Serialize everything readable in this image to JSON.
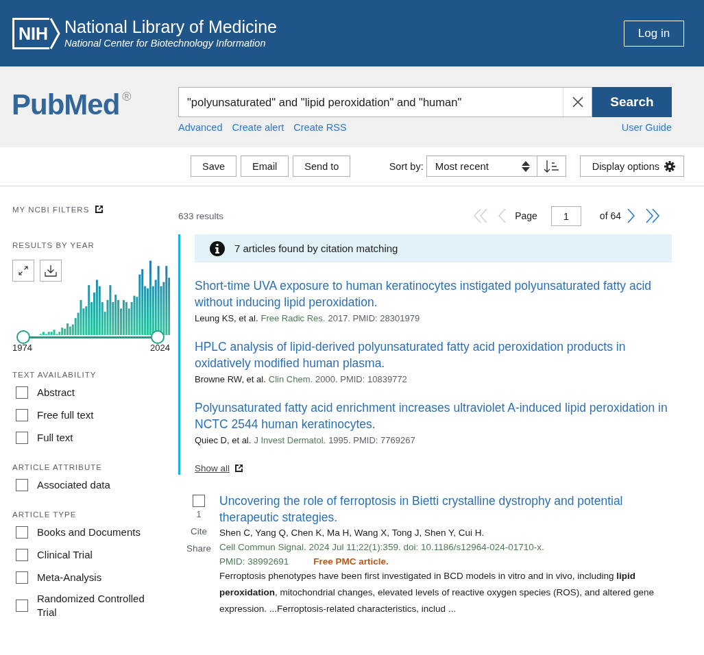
{
  "header": {
    "logo_mark": "NIH",
    "title": "National Library of Medicine",
    "subtitle": "National Center for Biotechnology Information",
    "login": "Log in"
  },
  "search": {
    "logo": "PubMed",
    "logo_mark": "®",
    "value": "\"polyunsaturated\" and \"lipid peroxidation\" and \"human\"",
    "button": "Search",
    "links": [
      "Advanced",
      "Create alert",
      "Create RSS"
    ],
    "guide": "User Guide"
  },
  "toolbar": {
    "buttons": [
      "Save",
      "Email",
      "Send to"
    ],
    "sort_label": "Sort by:",
    "sort_value": "Most recent",
    "display": "Display options"
  },
  "sidebar": {
    "my_filters": "MY NCBI FILTERS",
    "year_heading": "RESULTS BY YEAR",
    "year_start": "1974",
    "year_end": "2024",
    "year_range": [
      {
        "level": 0
      },
      {
        "level": 1
      }
    ],
    "groups": [
      {
        "heading": "TEXT AVAILABILITY",
        "options": [
          {
            "label": "Abstract",
            "checked": false
          },
          {
            "label": "Free full text",
            "checked": false
          },
          {
            "label": "Full text",
            "checked": false
          }
        ]
      },
      {
        "heading": "ARTICLE ATTRIBUTE",
        "options": [
          {
            "label": "Associated data",
            "checked": false
          }
        ]
      },
      {
        "heading": "ARTICLE TYPE",
        "options": [
          {
            "label": "Books and Documents",
            "checked": false
          },
          {
            "label": "Clinical Trial",
            "checked": false
          },
          {
            "label": "Meta-Analysis",
            "checked": false
          },
          {
            "label": "Randomized Controlled Trial",
            "checked": false
          }
        ]
      }
    ]
  },
  "results": {
    "count": "633 results",
    "pager": {
      "label": "Page",
      "value": "1",
      "of": "of 64"
    },
    "citation_box": {
      "message": "7 articles found by citation matching",
      "articles": [
        {
          "title": "Short-time UVA exposure to human keratinocytes instigated polyunsaturated fatty acid without inducing lipid peroxidation.",
          "authors": "Leung KS, et al.",
          "journal": "Free Radic Res.",
          "details": "2017. PMID: 28301979"
        },
        {
          "title": "HPLC analysis of lipid-derived polyunsaturated fatty acid peroxidation products in oxidatively modified human plasma.",
          "authors": "Browne RW, et al.",
          "journal": "Clin Chem.",
          "details": "2000. PMID: 10839772"
        },
        {
          "title": "Polyunsaturated fatty acid enrichment increases ultraviolet A-induced lipid peroxidation in NCTC 2544 human keratinocytes.",
          "authors": "Quiec D, et al.",
          "journal": "J Invest Dermatol.",
          "details": "1995. PMID: 7769267"
        }
      ],
      "show_all": "Show all"
    },
    "articles": [
      {
        "selected": false,
        "number": "1",
        "cite": "Cite",
        "share": "Share",
        "title": "Uncovering the role of ferroptosis in Bietti crystalline dystrophy and potential therapeutic strategies.",
        "authors": "Shen C, Yang Q, Chen K, Ma H, Wang X, Tong J, Shen Y, Cui H.",
        "citation": "Cell Commun Signal. 2024 Jul 11;22(1):359. doi: 10.1186/s12964-024-01710-x.",
        "pmid": "PMID: 38992691",
        "free": "Free PMC article.",
        "snippet": "Ferroptosis phenotypes have been first investigated in BCD models in vitro and in vivo, including **lipid peroxidation**, mitochondrial changes, elevated levels of reactive oxygen species (ROS), and altered gene expression. ...Ferroptosis-related characteristics, includ ..."
      }
    ]
  }
}
